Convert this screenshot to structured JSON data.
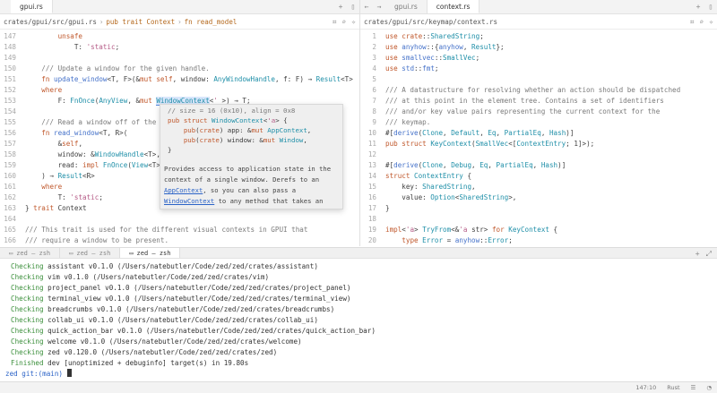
{
  "left_pane": {
    "tab": "gpui.rs",
    "breadcrumb": {
      "path": "crates/gpui/src/gpui.rs",
      "trait_item": "pub trait Context",
      "fn_item": "fn read_model"
    },
    "lines": [
      {
        "n": "147",
        "t": "        unsafe"
      },
      {
        "n": "148",
        "t": "            T: 'static;"
      },
      {
        "n": "149",
        "t": ""
      },
      {
        "n": "150",
        "t": "    /// Update a window for the given handle."
      },
      {
        "n": "151",
        "t": "    fn update_window<T, F>(&mut self, window: AnyWindowHandle, f: F) → Result<T>"
      },
      {
        "n": "152",
        "t": "    where"
      },
      {
        "n": "153",
        "t": "        F: FnOnce(AnyView, &mut WindowContext<'_>) → T;"
      },
      {
        "n": "154",
        "t": ""
      },
      {
        "n": "155",
        "t": "    /// Read a window off of the"
      },
      {
        "n": "156",
        "t": "    fn read_window<T, R>("
      },
      {
        "n": "157",
        "t": "        &self,"
      },
      {
        "n": "158",
        "t": "        window: &WindowHandle<T>,"
      },
      {
        "n": "159",
        "t": "        read: impl FnOnce(View<T>"
      },
      {
        "n": "160",
        "t": "    ) → Result<R>"
      },
      {
        "n": "161",
        "t": "    where"
      },
      {
        "n": "162",
        "t": "        T: 'static;"
      },
      {
        "n": "163",
        "t": "} trait Context"
      },
      {
        "n": "164",
        "t": ""
      },
      {
        "n": "165",
        "t": "/// This trait is used for the different visual contexts in GPUI that"
      },
      {
        "n": "166",
        "t": "/// require a window to be present."
      }
    ]
  },
  "popover": {
    "code_lines": [
      "// size = 16 (0x10), align = 0x8",
      "pub struct WindowContext<'a> {",
      "    pub(crate) app: &mut AppContext,",
      "    pub(crate) window: &mut Window,",
      "}"
    ],
    "doc_lines": [
      {
        "pre": "Provides access to application state in the",
        "link": "",
        "post": ""
      },
      {
        "pre": "context of a single window. Derefs to an",
        "link": "",
        "post": ""
      },
      {
        "pre": "",
        "link": "AppContext",
        "post": ", so you can also pass a"
      },
      {
        "pre": "",
        "link": "WindowContext",
        "post": " to any method that takes an"
      }
    ]
  },
  "right_pane": {
    "tabs": [
      "gpui.rs",
      "context.rs"
    ],
    "active_tab": "context.rs",
    "breadcrumb": "crates/gpui/src/keymap/context.rs",
    "lines": [
      {
        "n": "1",
        "t": "use crate::SharedString;"
      },
      {
        "n": "2",
        "t": "use anyhow::{anyhow, Result};"
      },
      {
        "n": "3",
        "t": "use smallvec::SmallVec;"
      },
      {
        "n": "4",
        "t": "use std::fmt;"
      },
      {
        "n": "5",
        "t": ""
      },
      {
        "n": "6",
        "t": "/// A datastructure for resolving whether an action should be dispatched"
      },
      {
        "n": "7",
        "t": "/// at this point in the element tree. Contains a set of identifiers"
      },
      {
        "n": "8",
        "t": "/// and/or key value pairs representing the current context for the"
      },
      {
        "n": "9",
        "t": "/// keymap."
      },
      {
        "n": "10",
        "t": "#[derive(Clone, Default, Eq, PartialEq, Hash)]"
      },
      {
        "n": "11",
        "t": "pub struct KeyContext(SmallVec<[ContextEntry; 1]>);"
      },
      {
        "n": "12",
        "t": ""
      },
      {
        "n": "13",
        "t": "#[derive(Clone, Debug, Eq, PartialEq, Hash)]"
      },
      {
        "n": "14",
        "t": "struct ContextEntry {"
      },
      {
        "n": "15",
        "t": "    key: SharedString,"
      },
      {
        "n": "16",
        "t": "    value: Option<SharedString>,"
      },
      {
        "n": "17",
        "t": "}"
      },
      {
        "n": "18",
        "t": ""
      },
      {
        "n": "19",
        "t": "impl<'a> TryFrom<&'a str> for KeyContext {"
      },
      {
        "n": "20",
        "t": "    type Error = anyhow::Error;"
      }
    ]
  },
  "terminal": {
    "tabs": [
      "zed — zsh",
      "zed — zsh",
      "zed — zsh"
    ],
    "active_index": 2,
    "lines": [
      {
        "s": "Checking",
        "r": " assistant v0.1.0 (/Users/natebutler/Code/zed/zed/crates/assistant)"
      },
      {
        "s": "Checking",
        "r": " vim v0.1.0 (/Users/natebutler/Code/zed/zed/crates/vim)"
      },
      {
        "s": "Checking",
        "r": " project_panel v0.1.0 (/Users/natebutler/Code/zed/zed/crates/project_panel)"
      },
      {
        "s": "Checking",
        "r": " terminal_view v0.1.0 (/Users/natebutler/Code/zed/zed/crates/terminal_view)"
      },
      {
        "s": "Checking",
        "r": " breadcrumbs v0.1.0 (/Users/natebutler/Code/zed/zed/crates/breadcrumbs)"
      },
      {
        "s": "Checking",
        "r": " collab_ui v0.1.0 (/Users/natebutler/Code/zed/zed/crates/collab_ui)"
      },
      {
        "s": "Checking",
        "r": " quick_action_bar v0.1.0 (/Users/natebutler/Code/zed/zed/crates/quick_action_bar)"
      },
      {
        "s": "Checking",
        "r": " welcome v0.1.0 (/Users/natebutler/Code/zed/zed/crates/welcome)"
      },
      {
        "s": "Checking",
        "r": " zed v0.120.0 (/Users/natebutler/Code/zed/zed/crates/zed)"
      },
      {
        "s": "Finished",
        "r": " dev [unoptimized + debuginfo] target(s) in 19.80s"
      }
    ],
    "prompt": "zed git:(main)"
  },
  "status": {
    "position": "147:10",
    "language": "Rust"
  }
}
